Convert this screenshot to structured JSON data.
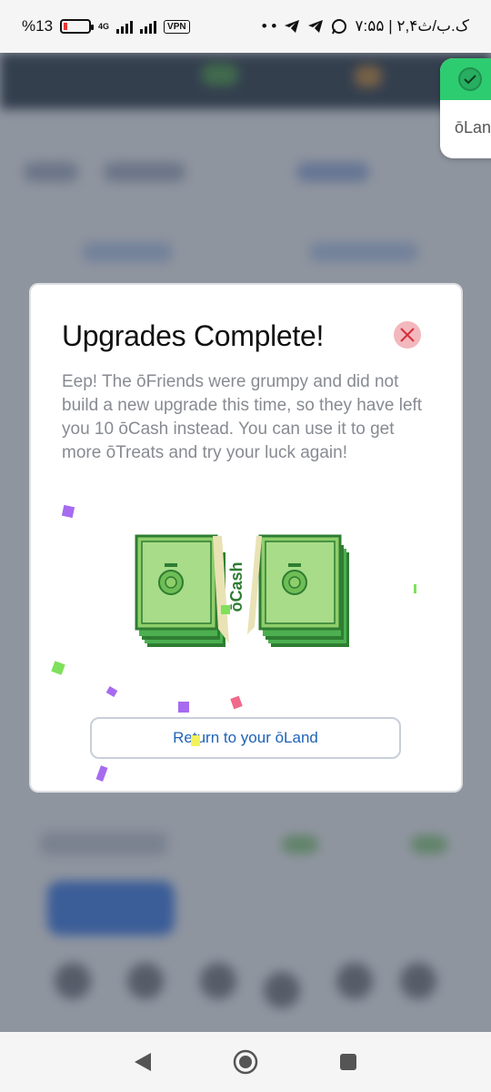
{
  "status_bar": {
    "battery": "%13",
    "network": "4G",
    "vpn": "VPN",
    "time": "۷:۵۵ | ۲,۴ک.ب/ث",
    "dots": "• •"
  },
  "toast": {
    "text": "ōLand"
  },
  "modal": {
    "title": "Upgrades Complete!",
    "body": "Eep! The ōFriends were grumpy and did not build a new upgrade this time, so they have left you 10 ōCash instead. You can use it to get more ōTreats and try your luck again!",
    "cash_label": "ōCash",
    "return_button": "Return to your ōLand"
  },
  "colors": {
    "accent_blue": "#1e63b8",
    "cash_green": "#8fce6b",
    "toast_green": "#2ecc71",
    "close_pink": "#f2b8bd"
  },
  "icons": {
    "close": "close-x-icon",
    "check": "check-icon",
    "nav_back": "back-triangle-icon",
    "nav_home": "home-circle-icon",
    "nav_recents": "recents-square-icon"
  }
}
